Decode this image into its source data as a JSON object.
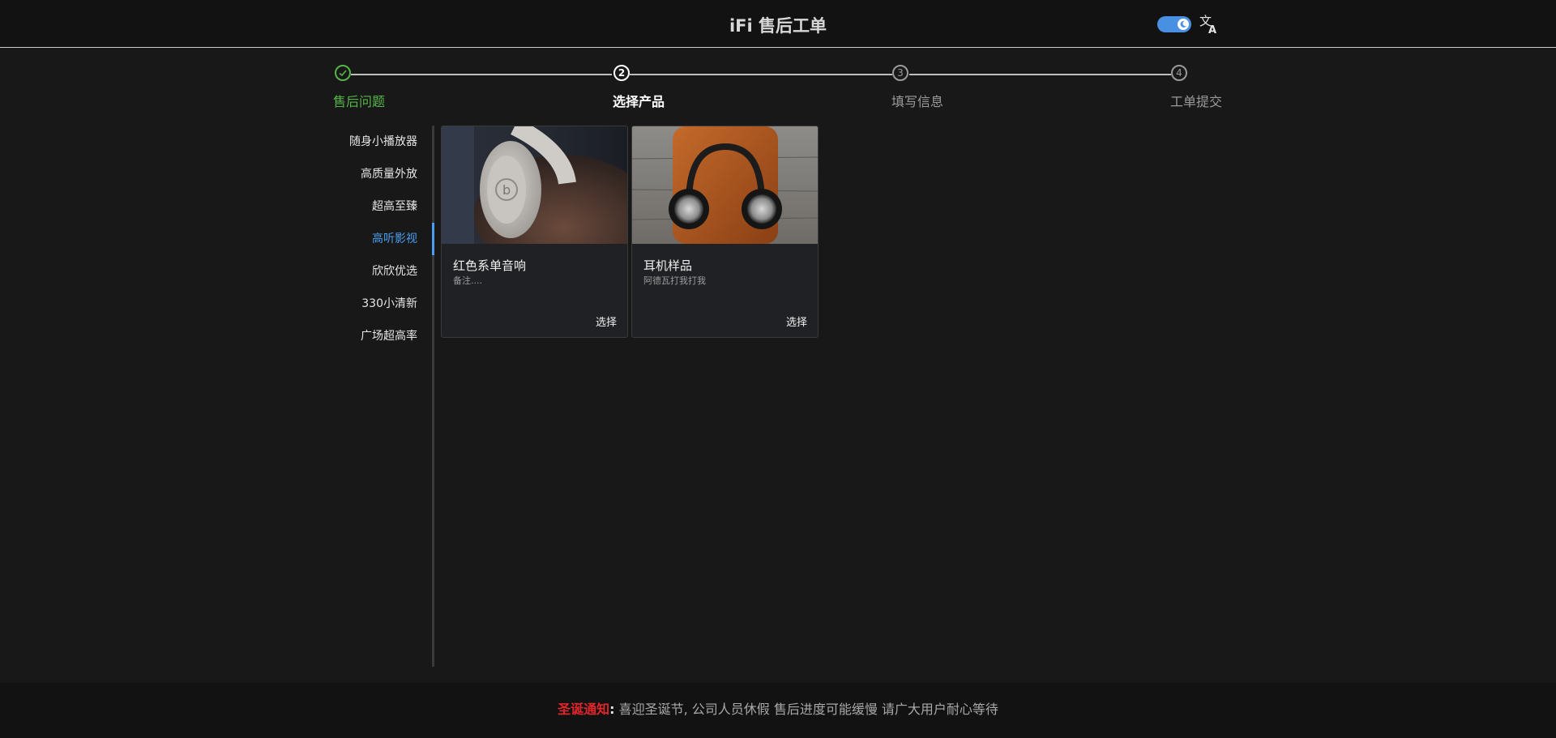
{
  "header": {
    "title": "iFi 售后工单",
    "theme_toggle_icon": "moon-icon",
    "language_icon": "translate-icon"
  },
  "steps": [
    {
      "number": "",
      "label": "售后问题",
      "state": "done"
    },
    {
      "number": "2",
      "label": "选择产品",
      "state": "active"
    },
    {
      "number": "3",
      "label": "填写信息",
      "state": "todo"
    },
    {
      "number": "4",
      "label": "工单提交",
      "state": "todo"
    }
  ],
  "sidebar": {
    "items": [
      {
        "label": "随身小播放器"
      },
      {
        "label": "高质量外放"
      },
      {
        "label": "超高至臻"
      },
      {
        "label": "高听影视"
      },
      {
        "label": "欣欣优选"
      },
      {
        "label": "330小清新"
      },
      {
        "label": "广场超高率"
      }
    ],
    "active_index": 3
  },
  "products": [
    {
      "name": "红色系单音响",
      "note": "备注....",
      "select_label": "选择",
      "image": "white-headphones-photo"
    },
    {
      "name": "耳机样品",
      "note": "阿德瓦打我打我",
      "select_label": "选择",
      "image": "headphones-on-leather-case-photo"
    }
  ],
  "footer": {
    "label": "圣诞通知",
    "colon": ":",
    "message": "喜迎圣诞节, 公司人员休假 售后进度可能缓慢 请广大用户耐心等待"
  },
  "colors": {
    "accent_blue": "#4a9ef0",
    "done_green": "#56b548",
    "notice_red": "#e0262a",
    "background": "#181818"
  }
}
